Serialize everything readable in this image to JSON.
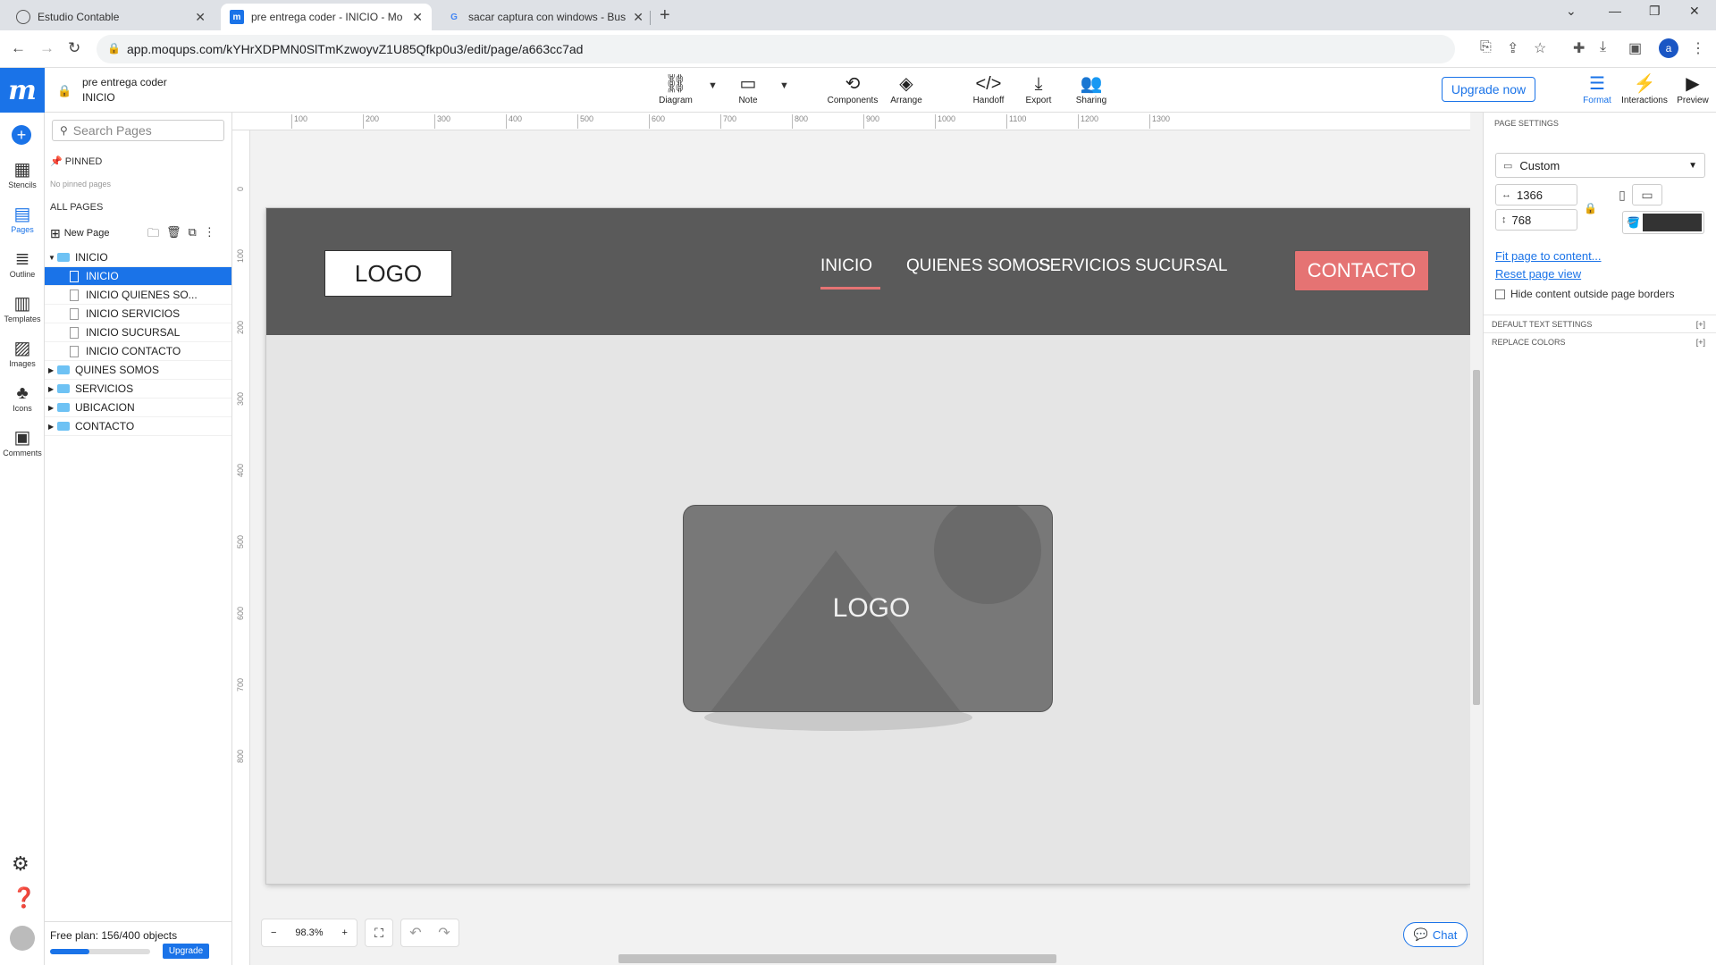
{
  "browser": {
    "tabs": [
      {
        "title": "Estudio Contable",
        "active": false
      },
      {
        "title": "pre entrega coder - INICIO - Mo",
        "active": true
      },
      {
        "title": "sacar captura con windows - Bus",
        "active": false
      }
    ],
    "url": "app.moqups.com/kYHrXDPMN0SlTmKzwoyvZ1U85Qfkp0u3/edit/page/a663cc7ad",
    "profile_initial": "a"
  },
  "app": {
    "project_name": "pre entrega coder",
    "current_page": "INICIO",
    "toolbar": [
      {
        "label": "Diagram",
        "icon": "diagram-icon"
      },
      {
        "label": "Note",
        "icon": "note-icon"
      },
      {
        "label": "Components",
        "icon": "components-icon"
      },
      {
        "label": "Arrange",
        "icon": "arrange-icon"
      },
      {
        "label": "Handoff",
        "icon": "handoff-icon"
      },
      {
        "label": "Export",
        "icon": "export-icon"
      },
      {
        "label": "Sharing",
        "icon": "sharing-icon"
      }
    ],
    "upgrade_label": "Upgrade now",
    "right_tools": [
      {
        "label": "Format",
        "icon": "format-icon",
        "active": true
      },
      {
        "label": "Interactions",
        "icon": "interactions-icon",
        "active": false
      },
      {
        "label": "Preview",
        "icon": "preview-icon",
        "active": false
      }
    ]
  },
  "rail": {
    "items": [
      {
        "label": "Stencils",
        "icon": "stencils-icon"
      },
      {
        "label": "Pages",
        "icon": "pages-icon",
        "active": true
      },
      {
        "label": "Outline",
        "icon": "outline-icon"
      },
      {
        "label": "Templates",
        "icon": "templates-icon"
      },
      {
        "label": "Images",
        "icon": "images-icon"
      },
      {
        "label": "Icons",
        "icon": "icons-icon"
      },
      {
        "label": "Comments",
        "icon": "comments-icon"
      }
    ]
  },
  "pages_panel": {
    "search_placeholder": "Search Pages",
    "pinned_label": "PINNED",
    "no_pinned": "No pinned pages",
    "all_pages_label": "ALL PAGES",
    "new_page_label": "New Page",
    "tree": [
      {
        "label": "INICIO",
        "type": "folder",
        "expanded": true
      },
      {
        "label": "INICIO",
        "type": "page",
        "selected": true
      },
      {
        "label": "INICIO QUIENES SO...",
        "type": "page"
      },
      {
        "label": "INICIO SERVICIOS",
        "type": "page"
      },
      {
        "label": "INICIO SUCURSAL",
        "type": "page"
      },
      {
        "label": "INICIO CONTACTO",
        "type": "page"
      },
      {
        "label": "QUINES SOMOS",
        "type": "folder"
      },
      {
        "label": "SERVICIOS",
        "type": "folder"
      },
      {
        "label": "UBICACION",
        "type": "folder"
      },
      {
        "label": "CONTACTO",
        "type": "folder"
      }
    ],
    "free_plan_text": "Free plan: 156/400 objects",
    "free_plan_progress": 0.39,
    "upgrade_label": "Upgrade"
  },
  "canvas": {
    "ruler_top": [
      "0",
      "100",
      "200",
      "300",
      "400",
      "500",
      "600",
      "700",
      "800",
      "900",
      "1000",
      "1100",
      "1200",
      "1300"
    ],
    "ruler_left": [
      "0",
      "100",
      "200",
      "300",
      "400",
      "500",
      "600",
      "700",
      "800"
    ],
    "mockup": {
      "logo_text": "LOGO",
      "menu": [
        "INICIO",
        "QUIENES SOMOS",
        "SERVICIOS",
        "SUCURSAL"
      ],
      "contact_label": "CONTACTO",
      "image_label": "LOGO",
      "nav_color": "#5a5a5a",
      "accent_color": "#e57373"
    },
    "zoom": "98.3%",
    "chat_label": "Chat"
  },
  "page_settings": {
    "title": "PAGE SETTINGS",
    "size_preset": "Custom",
    "width": "1366",
    "height": "768",
    "fill_color": "#333333",
    "fit_link": "Fit page to content...",
    "reset_link": "Reset page view",
    "hide_outside_label": "Hide content outside page borders",
    "sections": [
      "DEFAULT TEXT SETTINGS",
      "REPLACE COLORS"
    ],
    "section_toggle": "[+]"
  }
}
